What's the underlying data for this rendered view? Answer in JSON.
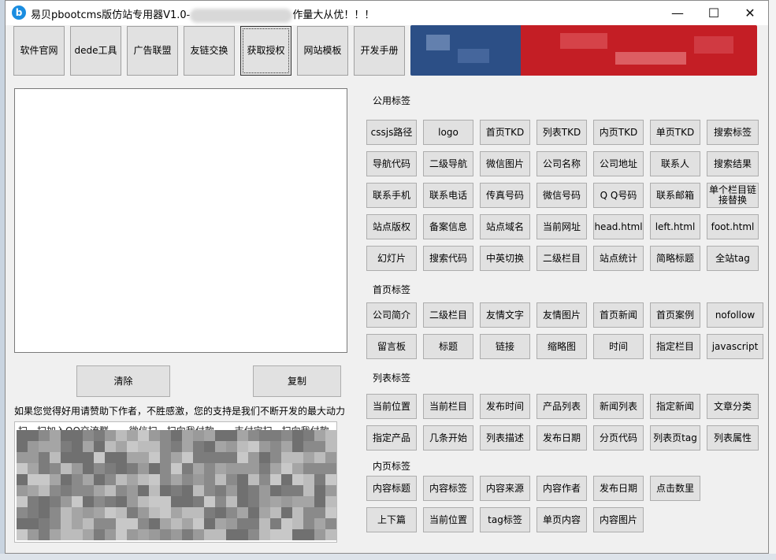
{
  "window": {
    "title": "易贝pbootcms版仿站专用器V1.0-",
    "title_suffix": "作量大从优！！！",
    "min_label": "—",
    "max_label": "☐",
    "close_label": "✕"
  },
  "toolbar": {
    "items": [
      "软件官网",
      "dede工具",
      "广告联盟",
      "友链交换",
      "获取授权",
      "网站模板",
      "开发手册"
    ],
    "active_index": 4
  },
  "actions": {
    "clear_label": "清除",
    "copy_label": "复制"
  },
  "support_text": "如果您觉得好用请赞助下作者，不胜感激，您的支持是我们不断开发的最大动力",
  "qr_labels": [
    "扫一扫加入QQ交流群",
    "微信扫一扫向我付款",
    "支付宝扫一扫向我付款"
  ],
  "sections": [
    {
      "label": "公用标签",
      "rows": [
        [
          "cssjs路径",
          "logo",
          "首页TKD",
          "列表TKD",
          "内页TKD",
          "单页TKD",
          "搜索标签"
        ],
        [
          "导航代码",
          "二级导航",
          "微信图片",
          "公司名称",
          "公司地址",
          "联系人",
          "搜索结果"
        ],
        [
          "联系手机",
          "联系电话",
          "传真号码",
          "微信号码",
          "Q Q号码",
          "联系邮箱",
          "单个栏目链接替换"
        ],
        [
          "站点版权",
          "备案信息",
          "站点域名",
          "当前网址",
          "head.html",
          "left.html",
          "foot.html"
        ],
        [
          "幻灯片",
          "搜索代码",
          "中英切换",
          "二级栏目",
          "站点统计",
          "简略标题",
          "全站tag"
        ]
      ]
    },
    {
      "label": "首页标签",
      "rows": [
        [
          "公司简介",
          "二级栏目",
          "友情文字",
          "友情图片",
          "首页新闻",
          "首页案例",
          "nofollow"
        ],
        [
          "留言板",
          "标题",
          "链接",
          "缩略图",
          "时间",
          "指定栏目",
          "javascript"
        ]
      ]
    },
    {
      "label": "列表标签",
      "rows": [
        [
          "当前位置",
          "当前栏目",
          "发布时间",
          "产品列表",
          "新闻列表",
          "指定新闻",
          "文章分类"
        ],
        [
          "指定产品",
          "几条开始",
          "列表描述",
          "发布日期",
          "分页代码",
          "列表页tag",
          "列表属性"
        ]
      ]
    },
    {
      "label": "内页标签",
      "rows": [
        [
          "内容标题",
          "内容标签",
          "内容来源",
          "内容作者",
          "发布日期",
          "点击数里"
        ],
        [
          "上下篇",
          "当前位置",
          "tag标签",
          "单页内容",
          "内容图片"
        ]
      ]
    }
  ]
}
